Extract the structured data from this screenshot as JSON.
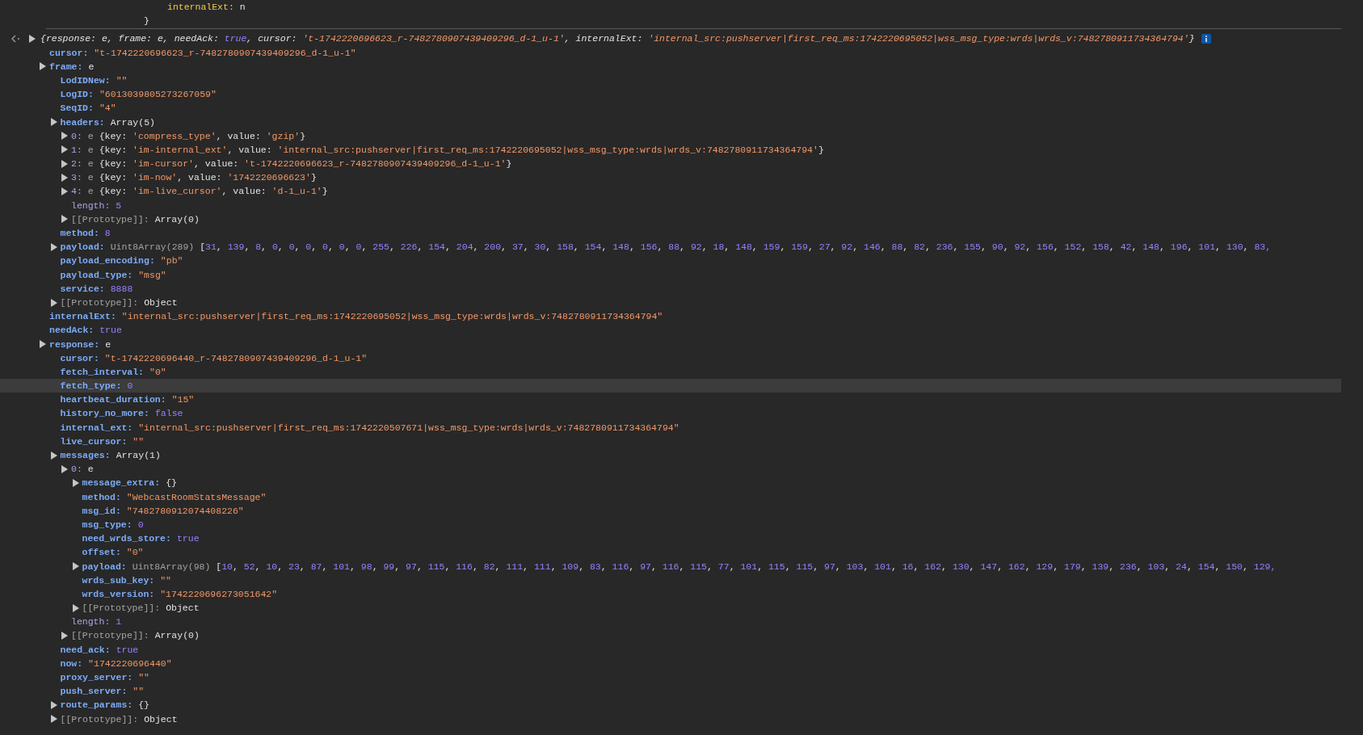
{
  "previous_output": [
    {
      "kind": "property",
      "key": "internalExt:",
      "value": "n"
    },
    {
      "kind": "brace",
      "text": "}"
    }
  ],
  "log": {
    "summary": [
      {
        "kind": "plain",
        "text": "{response: e, frame: e, needAck: "
      },
      {
        "kind": "number",
        "text": "true"
      },
      {
        "kind": "plain",
        "text": ", cursor: "
      },
      {
        "kind": "string",
        "text": "'t-1742220696623_r-7482780907439409296_d-1_u-1'"
      },
      {
        "kind": "plain",
        "text": ", internalExt: "
      },
      {
        "kind": "string",
        "text": "'internal_src:pushserver|first_req_ms:1742220695052|wss_msg_type:wrds|wrds_v:7482780911734364794'"
      },
      {
        "kind": "plain",
        "text": "}"
      }
    ],
    "tree": [
      {
        "key": {
          "kind": "own",
          "text": "cursor:"
        },
        "kind": "leaf",
        "selected": false,
        "value": [
          {
            "kind": "string",
            "text": "\"t-1742220696623_r-7482780907439409296_d-1_u-1\""
          }
        ]
      },
      {
        "key": {
          "kind": "own",
          "text": "frame:"
        },
        "kind": "expandable",
        "selected": false,
        "value": [
          {
            "kind": "plain",
            "text": "e"
          }
        ],
        "children": [
          {
            "key": {
              "kind": "own",
              "text": "LodIDNew:"
            },
            "kind": "leaf",
            "selected": false,
            "value": [
              {
                "kind": "string",
                "text": "\"\""
              }
            ]
          },
          {
            "key": {
              "kind": "own",
              "text": "LogID:"
            },
            "kind": "leaf",
            "selected": false,
            "value": [
              {
                "kind": "string",
                "text": "\"6013039805273267059\""
              }
            ]
          },
          {
            "key": {
              "kind": "own",
              "text": "SeqID:"
            },
            "kind": "leaf",
            "selected": false,
            "value": [
              {
                "kind": "string",
                "text": "\"4\""
              }
            ]
          },
          {
            "key": {
              "kind": "own",
              "text": "headers:"
            },
            "kind": "expandable",
            "selected": false,
            "value": [
              {
                "kind": "plain",
                "text": "Array(5)"
              }
            ],
            "children": [
              {
                "key": {
                  "kind": "index",
                  "text": "0:"
                },
                "kind": "expandable",
                "selected": false,
                "value": [
                  {
                    "kind": "dim",
                    "text": "e "
                  },
                  {
                    "kind": "plain",
                    "text": "{key: "
                  },
                  {
                    "kind": "string",
                    "text": "'compress_type'"
                  },
                  {
                    "kind": "plain",
                    "text": ", value: "
                  },
                  {
                    "kind": "string",
                    "text": "'gzip'"
                  },
                  {
                    "kind": "plain",
                    "text": "}"
                  }
                ]
              },
              {
                "key": {
                  "kind": "index",
                  "text": "1:"
                },
                "kind": "expandable",
                "selected": false,
                "value": [
                  {
                    "kind": "dim",
                    "text": "e "
                  },
                  {
                    "kind": "plain",
                    "text": "{key: "
                  },
                  {
                    "kind": "string",
                    "text": "'im-internal_ext'"
                  },
                  {
                    "kind": "plain",
                    "text": ", value: "
                  },
                  {
                    "kind": "string",
                    "text": "'internal_src:pushserver|first_req_ms:1742220695052|wss_msg_type:wrds|wrds_v:7482780911734364794'"
                  },
                  {
                    "kind": "plain",
                    "text": "}"
                  }
                ]
              },
              {
                "key": {
                  "kind": "index",
                  "text": "2:"
                },
                "kind": "expandable",
                "selected": false,
                "value": [
                  {
                    "kind": "dim",
                    "text": "e "
                  },
                  {
                    "kind": "plain",
                    "text": "{key: "
                  },
                  {
                    "kind": "string",
                    "text": "'im-cursor'"
                  },
                  {
                    "kind": "plain",
                    "text": ", value: "
                  },
                  {
                    "kind": "string",
                    "text": "'t-1742220696623_r-7482780907439409296_d-1_u-1'"
                  },
                  {
                    "kind": "plain",
                    "text": "}"
                  }
                ]
              },
              {
                "key": {
                  "kind": "index",
                  "text": "3:"
                },
                "kind": "expandable",
                "selected": false,
                "value": [
                  {
                    "kind": "dim",
                    "text": "e "
                  },
                  {
                    "kind": "plain",
                    "text": "{key: "
                  },
                  {
                    "kind": "string",
                    "text": "'im-now'"
                  },
                  {
                    "kind": "plain",
                    "text": ", value: "
                  },
                  {
                    "kind": "string",
                    "text": "'1742220696623'"
                  },
                  {
                    "kind": "plain",
                    "text": "}"
                  }
                ]
              },
              {
                "key": {
                  "kind": "index",
                  "text": "4:"
                },
                "kind": "expandable",
                "selected": false,
                "value": [
                  {
                    "kind": "dim",
                    "text": "e "
                  },
                  {
                    "kind": "plain",
                    "text": "{key: "
                  },
                  {
                    "kind": "string",
                    "text": "'im-live_cursor'"
                  },
                  {
                    "kind": "plain",
                    "text": ", value: "
                  },
                  {
                    "kind": "string",
                    "text": "'d-1_u-1'"
                  },
                  {
                    "kind": "plain",
                    "text": "}"
                  }
                ]
              },
              {
                "key": {
                  "kind": "index",
                  "text": "length:"
                },
                "kind": "leaf",
                "selected": false,
                "value": [
                  {
                    "kind": "number",
                    "text": "5"
                  }
                ]
              },
              {
                "key": {
                  "kind": "internal",
                  "text": "[[Prototype]]:"
                },
                "kind": "expandable",
                "selected": false,
                "value": [
                  {
                    "kind": "plain",
                    "text": "Array(0)"
                  }
                ]
              }
            ]
          },
          {
            "key": {
              "kind": "own",
              "text": "method:"
            },
            "kind": "leaf",
            "selected": false,
            "value": [
              {
                "kind": "number",
                "text": "8"
              }
            ]
          },
          {
            "key": {
              "kind": "own",
              "text": "payload:"
            },
            "kind": "expandable",
            "selected": false,
            "value": [
              {
                "kind": "dim",
                "text": "Uint8Array(289) "
              },
              {
                "kind": "plain",
                "text": "["
              },
              {
                "kind": "array",
                "text": "31, 139, 8, 0, 0, 0, 0, 0, 0, 255, 226, 154, 204, 200, 37, 30, 158, 154, 148, 156, 88, 92, 18, 148, 159, 159, 27, 92, 146, 88, 82, 236, 155, 90, 92, 156, 152, 158, 42, 148, 196, 101, 130, 83,"
              }
            ]
          },
          {
            "key": {
              "kind": "own",
              "text": "payload_encoding:"
            },
            "kind": "leaf",
            "selected": false,
            "value": [
              {
                "kind": "string",
                "text": "\"pb\""
              }
            ]
          },
          {
            "key": {
              "kind": "own",
              "text": "payload_type:"
            },
            "kind": "leaf",
            "selected": false,
            "value": [
              {
                "kind": "string",
                "text": "\"msg\""
              }
            ]
          },
          {
            "key": {
              "kind": "own",
              "text": "service:"
            },
            "kind": "leaf",
            "selected": false,
            "value": [
              {
                "kind": "number",
                "text": "8888"
              }
            ]
          },
          {
            "key": {
              "kind": "internal",
              "text": "[[Prototype]]:"
            },
            "kind": "expandable",
            "selected": false,
            "value": [
              {
                "kind": "plain",
                "text": "Object"
              }
            ]
          }
        ]
      },
      {
        "key": {
          "kind": "own",
          "text": "internalExt:"
        },
        "kind": "leaf",
        "selected": false,
        "value": [
          {
            "kind": "string",
            "text": "\"internal_src:pushserver|first_req_ms:1742220695052|wss_msg_type:wrds|wrds_v:7482780911734364794\""
          }
        ]
      },
      {
        "key": {
          "kind": "own",
          "text": "needAck:"
        },
        "kind": "leaf",
        "selected": false,
        "value": [
          {
            "kind": "number",
            "text": "true"
          }
        ]
      },
      {
        "key": {
          "kind": "own",
          "text": "response:"
        },
        "kind": "expandable",
        "selected": false,
        "value": [
          {
            "kind": "plain",
            "text": "e"
          }
        ],
        "children": [
          {
            "key": {
              "kind": "own",
              "text": "cursor:"
            },
            "kind": "leaf",
            "selected": false,
            "value": [
              {
                "kind": "string",
                "text": "\"t-1742220696440_r-7482780907439409296_d-1_u-1\""
              }
            ]
          },
          {
            "key": {
              "kind": "own",
              "text": "fetch_interval:"
            },
            "kind": "leaf",
            "selected": false,
            "value": [
              {
                "kind": "string",
                "text": "\"0\""
              }
            ]
          },
          {
            "key": {
              "kind": "own",
              "text": "fetch_type:"
            },
            "kind": "leaf",
            "selected": true,
            "value": [
              {
                "kind": "number",
                "text": "0"
              }
            ]
          },
          {
            "key": {
              "kind": "own",
              "text": "heartbeat_duration:"
            },
            "kind": "leaf",
            "selected": false,
            "value": [
              {
                "kind": "string",
                "text": "\"15\""
              }
            ]
          },
          {
            "key": {
              "kind": "own",
              "text": "history_no_more:"
            },
            "kind": "leaf",
            "selected": false,
            "value": [
              {
                "kind": "number",
                "text": "false"
              }
            ]
          },
          {
            "key": {
              "kind": "own",
              "text": "internal_ext:"
            },
            "kind": "leaf",
            "selected": false,
            "value": [
              {
                "kind": "string",
                "text": "\"internal_src:pushserver|first_req_ms:1742220507671|wss_msg_type:wrds|wrds_v:7482780911734364794\""
              }
            ]
          },
          {
            "key": {
              "kind": "own",
              "text": "live_cursor:"
            },
            "kind": "leaf",
            "selected": false,
            "value": [
              {
                "kind": "string",
                "text": "\"\""
              }
            ]
          },
          {
            "key": {
              "kind": "own",
              "text": "messages:"
            },
            "kind": "expandable",
            "selected": false,
            "value": [
              {
                "kind": "plain",
                "text": "Array(1)"
              }
            ],
            "children": [
              {
                "key": {
                  "kind": "index",
                  "text": "0:"
                },
                "kind": "expandable",
                "selected": false,
                "value": [
                  {
                    "kind": "plain",
                    "text": "e"
                  }
                ],
                "children": [
                  {
                    "key": {
                      "kind": "own",
                      "text": "message_extra:"
                    },
                    "kind": "expandable",
                    "selected": false,
                    "value": [
                      {
                        "kind": "plain",
                        "text": "{}"
                      }
                    ]
                  },
                  {
                    "key": {
                      "kind": "own",
                      "text": "method:"
                    },
                    "kind": "leaf",
                    "selected": false,
                    "value": [
                      {
                        "kind": "string",
                        "text": "\"WebcastRoomStatsMessage\""
                      }
                    ]
                  },
                  {
                    "key": {
                      "kind": "own",
                      "text": "msg_id:"
                    },
                    "kind": "leaf",
                    "selected": false,
                    "value": [
                      {
                        "kind": "string",
                        "text": "\"7482780912074408226\""
                      }
                    ]
                  },
                  {
                    "key": {
                      "kind": "own",
                      "text": "msg_type:"
                    },
                    "kind": "leaf",
                    "selected": false,
                    "value": [
                      {
                        "kind": "number",
                        "text": "0"
                      }
                    ]
                  },
                  {
                    "key": {
                      "kind": "own",
                      "text": "need_wrds_store:"
                    },
                    "kind": "leaf",
                    "selected": false,
                    "value": [
                      {
                        "kind": "number",
                        "text": "true"
                      }
                    ]
                  },
                  {
                    "key": {
                      "kind": "own",
                      "text": "offset:"
                    },
                    "kind": "leaf",
                    "selected": false,
                    "value": [
                      {
                        "kind": "string",
                        "text": "\"0\""
                      }
                    ]
                  },
                  {
                    "key": {
                      "kind": "own",
                      "text": "payload:"
                    },
                    "kind": "expandable",
                    "selected": false,
                    "value": [
                      {
                        "kind": "dim",
                        "text": "Uint8Array(98) "
                      },
                      {
                        "kind": "plain",
                        "text": "["
                      },
                      {
                        "kind": "array",
                        "text": "10, 52, 10, 23, 87, 101, 98, 99, 97, 115, 116, 82, 111, 111, 109, 83, 116, 97, 116, 115, 77, 101, 115, 115, 97, 103, 101, 16, 162, 130, 147, 162, 129, 179, 139, 236, 103, 24, 154, 150, 129,"
                      }
                    ]
                  },
                  {
                    "key": {
                      "kind": "own",
                      "text": "wrds_sub_key:"
                    },
                    "kind": "leaf",
                    "selected": false,
                    "value": [
                      {
                        "kind": "string",
                        "text": "\"\""
                      }
                    ]
                  },
                  {
                    "key": {
                      "kind": "own",
                      "text": "wrds_version:"
                    },
                    "kind": "leaf",
                    "selected": false,
                    "value": [
                      {
                        "kind": "string",
                        "text": "\"1742220696273051642\""
                      }
                    ]
                  },
                  {
                    "key": {
                      "kind": "internal",
                      "text": "[[Prototype]]:"
                    },
                    "kind": "expandable",
                    "selected": false,
                    "value": [
                      {
                        "kind": "plain",
                        "text": "Object"
                      }
                    ]
                  }
                ]
              },
              {
                "key": {
                  "kind": "index",
                  "text": "length:"
                },
                "kind": "leaf",
                "selected": false,
                "value": [
                  {
                    "kind": "number",
                    "text": "1"
                  }
                ]
              },
              {
                "key": {
                  "kind": "internal",
                  "text": "[[Prototype]]:"
                },
                "kind": "expandable",
                "selected": false,
                "value": [
                  {
                    "kind": "plain",
                    "text": "Array(0)"
                  }
                ]
              }
            ]
          },
          {
            "key": {
              "kind": "own",
              "text": "need_ack:"
            },
            "kind": "leaf",
            "selected": false,
            "value": [
              {
                "kind": "number",
                "text": "true"
              }
            ]
          },
          {
            "key": {
              "kind": "own",
              "text": "now:"
            },
            "kind": "leaf",
            "selected": false,
            "value": [
              {
                "kind": "string",
                "text": "\"1742220696440\""
              }
            ]
          },
          {
            "key": {
              "kind": "own",
              "text": "proxy_server:"
            },
            "kind": "leaf",
            "selected": false,
            "value": [
              {
                "kind": "string",
                "text": "\"\""
              }
            ]
          },
          {
            "key": {
              "kind": "own",
              "text": "push_server:"
            },
            "kind": "leaf",
            "selected": false,
            "value": [
              {
                "kind": "string",
                "text": "\"\""
              }
            ]
          },
          {
            "key": {
              "kind": "own",
              "text": "route_params:"
            },
            "kind": "expandable",
            "selected": false,
            "value": [
              {
                "kind": "plain",
                "text": "{}"
              }
            ]
          },
          {
            "key": {
              "kind": "internal",
              "text": "[[Prototype]]:"
            },
            "kind": "expandable",
            "selected": false,
            "value": [
              {
                "kind": "plain",
                "text": "Object"
              }
            ]
          }
        ]
      }
    ]
  }
}
